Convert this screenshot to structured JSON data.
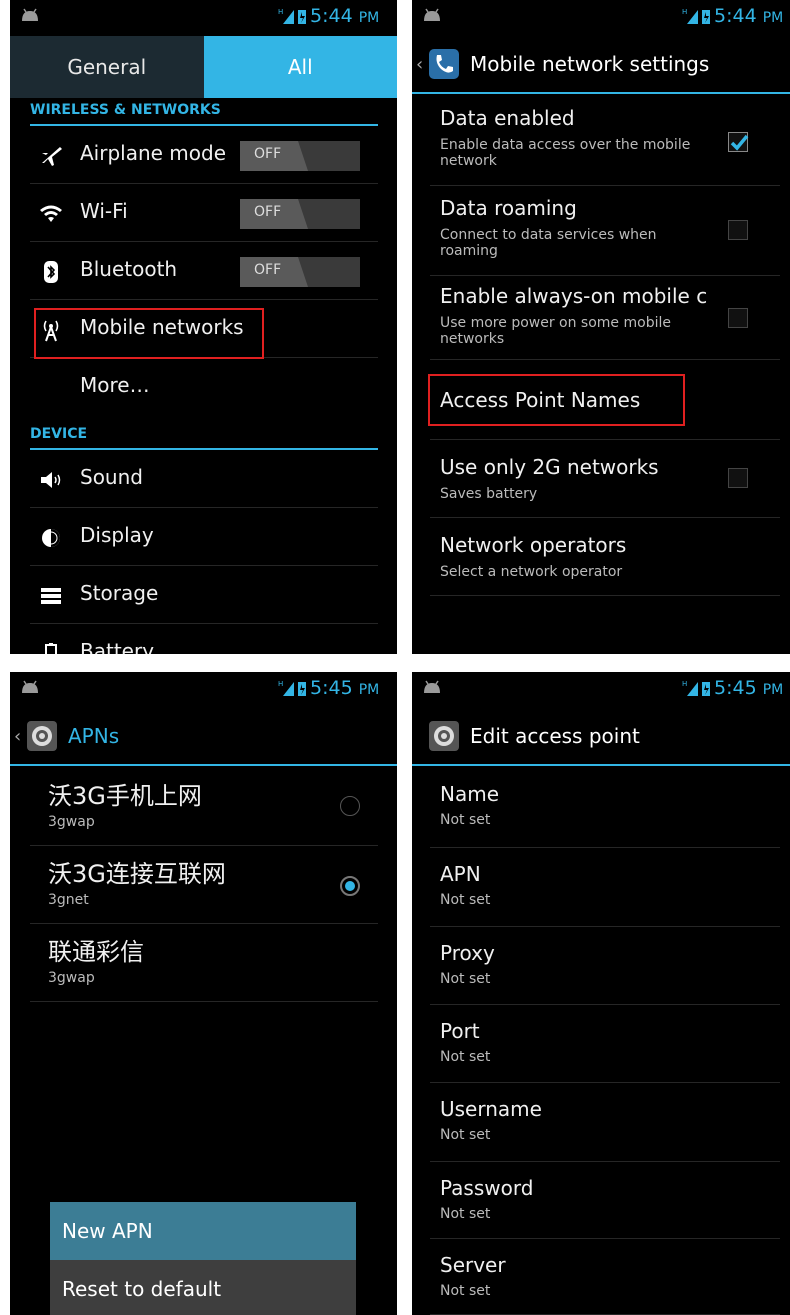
{
  "colors": {
    "accent": "#33b5e5",
    "highlight": "#e02020"
  },
  "panel1": {
    "time": "5:44",
    "ampm": "PM",
    "tabs": [
      "General",
      "All"
    ],
    "section_wireless": "WIRELESS & NETWORKS",
    "airplane": {
      "label": "Airplane mode",
      "toggle": "OFF"
    },
    "wifi": {
      "label": "Wi-Fi",
      "toggle": "OFF"
    },
    "bluetooth": {
      "label": "Bluetooth",
      "toggle": "OFF"
    },
    "mobile_networks": "Mobile networks",
    "more": "More…",
    "section_device": "DEVICE",
    "sound": "Sound",
    "display": "Display",
    "storage": "Storage",
    "battery": "Battery"
  },
  "panel2": {
    "time": "5:44",
    "ampm": "PM",
    "title": "Mobile network settings",
    "data_enabled": {
      "title": "Data enabled",
      "summary": "Enable data access over the mobile network",
      "checked": true
    },
    "data_roaming": {
      "title": "Data roaming",
      "summary": "Connect to data services when roaming",
      "checked": false
    },
    "always_on": {
      "title": "Enable always-on mobile c",
      "summary": "Use more power on some mobile networks",
      "checked": false
    },
    "apn": "Access Point Names",
    "only2g": {
      "title": "Use only 2G networks",
      "summary": "Saves battery",
      "checked": false
    },
    "operators": {
      "title": "Network operators",
      "summary": "Select a network operator"
    }
  },
  "panel3": {
    "time": "5:45",
    "ampm": "PM",
    "title": "APNs",
    "apns": [
      {
        "name": "沃3G手机上网",
        "apn": "3gwap",
        "selected": false
      },
      {
        "name": "沃3G连接互联网",
        "apn": "3gnet",
        "selected": true
      },
      {
        "name": "联通彩信",
        "apn": "3gwap"
      }
    ],
    "menu": [
      "New APN",
      "Reset to default"
    ]
  },
  "panel4": {
    "time": "5:45",
    "ampm": "PM",
    "title": "Edit access point",
    "fields": [
      {
        "label": "Name",
        "value": "Not set"
      },
      {
        "label": "APN",
        "value": "Not set"
      },
      {
        "label": "Proxy",
        "value": "Not set"
      },
      {
        "label": "Port",
        "value": "Not set"
      },
      {
        "label": "Username",
        "value": "Not set"
      },
      {
        "label": "Password",
        "value": "Not set"
      },
      {
        "label": "Server",
        "value": "Not set"
      }
    ]
  }
}
